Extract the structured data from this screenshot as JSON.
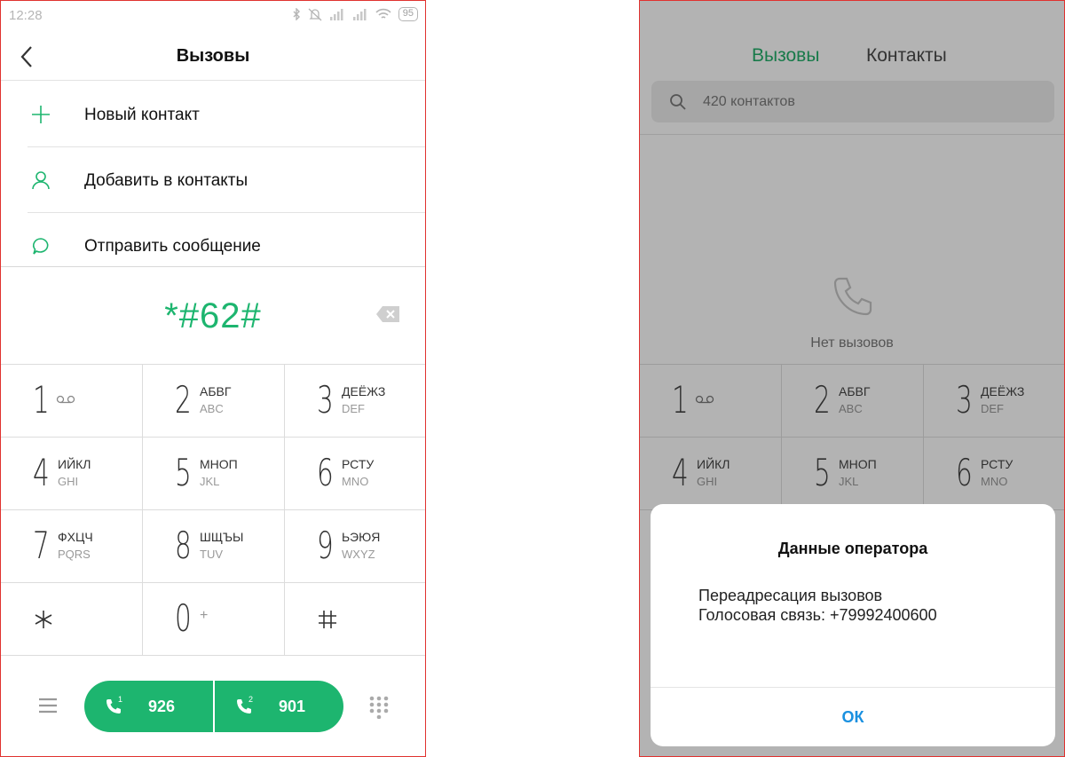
{
  "left": {
    "status": {
      "time": "12:28",
      "battery": "95"
    },
    "header": {
      "title": "Вызовы"
    },
    "menu": [
      {
        "label": "Новый контакт",
        "icon": "plus-icon"
      },
      {
        "label": "Добавить в контакты",
        "icon": "person-icon"
      },
      {
        "label": "Отправить сообщение",
        "icon": "message-icon"
      }
    ],
    "number": "*#62#",
    "keypad": [
      {
        "digit": "1",
        "l1": "",
        "l2": ""
      },
      {
        "digit": "2",
        "l1": "АБВГ",
        "l2": "ABC"
      },
      {
        "digit": "3",
        "l1": "ДЕЁЖЗ",
        "l2": "DEF"
      },
      {
        "digit": "4",
        "l1": "ИЙКЛ",
        "l2": "GHI"
      },
      {
        "digit": "5",
        "l1": "МНОП",
        "l2": "JKL"
      },
      {
        "digit": "6",
        "l1": "РСТУ",
        "l2": "MNO"
      },
      {
        "digit": "7",
        "l1": "ФХЦЧ",
        "l2": "PQRS"
      },
      {
        "digit": "8",
        "l1": "ШЩЪЫ",
        "l2": "TUV"
      },
      {
        "digit": "9",
        "l1": "ЬЭЮЯ",
        "l2": "WXYZ"
      },
      {
        "digit": "*",
        "l1": "",
        "l2": ""
      },
      {
        "digit": "0",
        "l1": "+",
        "l2": ""
      },
      {
        "digit": "#",
        "l1": "",
        "l2": ""
      }
    ],
    "calls": [
      {
        "sim": "1",
        "label": "926"
      },
      {
        "sim": "2",
        "label": "901"
      }
    ],
    "accent": "#1db56f"
  },
  "right": {
    "tabs": {
      "active": "Вызовы",
      "inactive": "Контакты"
    },
    "search": {
      "placeholder": "420 контактов"
    },
    "empty": "Нет вызовов",
    "keypad": [
      {
        "digit": "1",
        "l1": "",
        "l2": ""
      },
      {
        "digit": "2",
        "l1": "АБВГ",
        "l2": "ABC"
      },
      {
        "digit": "3",
        "l1": "ДЕЁЖЗ",
        "l2": "DEF"
      },
      {
        "digit": "4",
        "l1": "ИЙКЛ",
        "l2": "GHI"
      },
      {
        "digit": "5",
        "l1": "МНОП",
        "l2": "JKL"
      },
      {
        "digit": "6",
        "l1": "РСТУ",
        "l2": "MNO"
      }
    ],
    "dialog": {
      "title": "Данные оператора",
      "line1": "Переадресация вызовов",
      "line2": "Голосовая связь: +79992400600",
      "ok": "ОК"
    },
    "link_color": "#1990e0"
  }
}
